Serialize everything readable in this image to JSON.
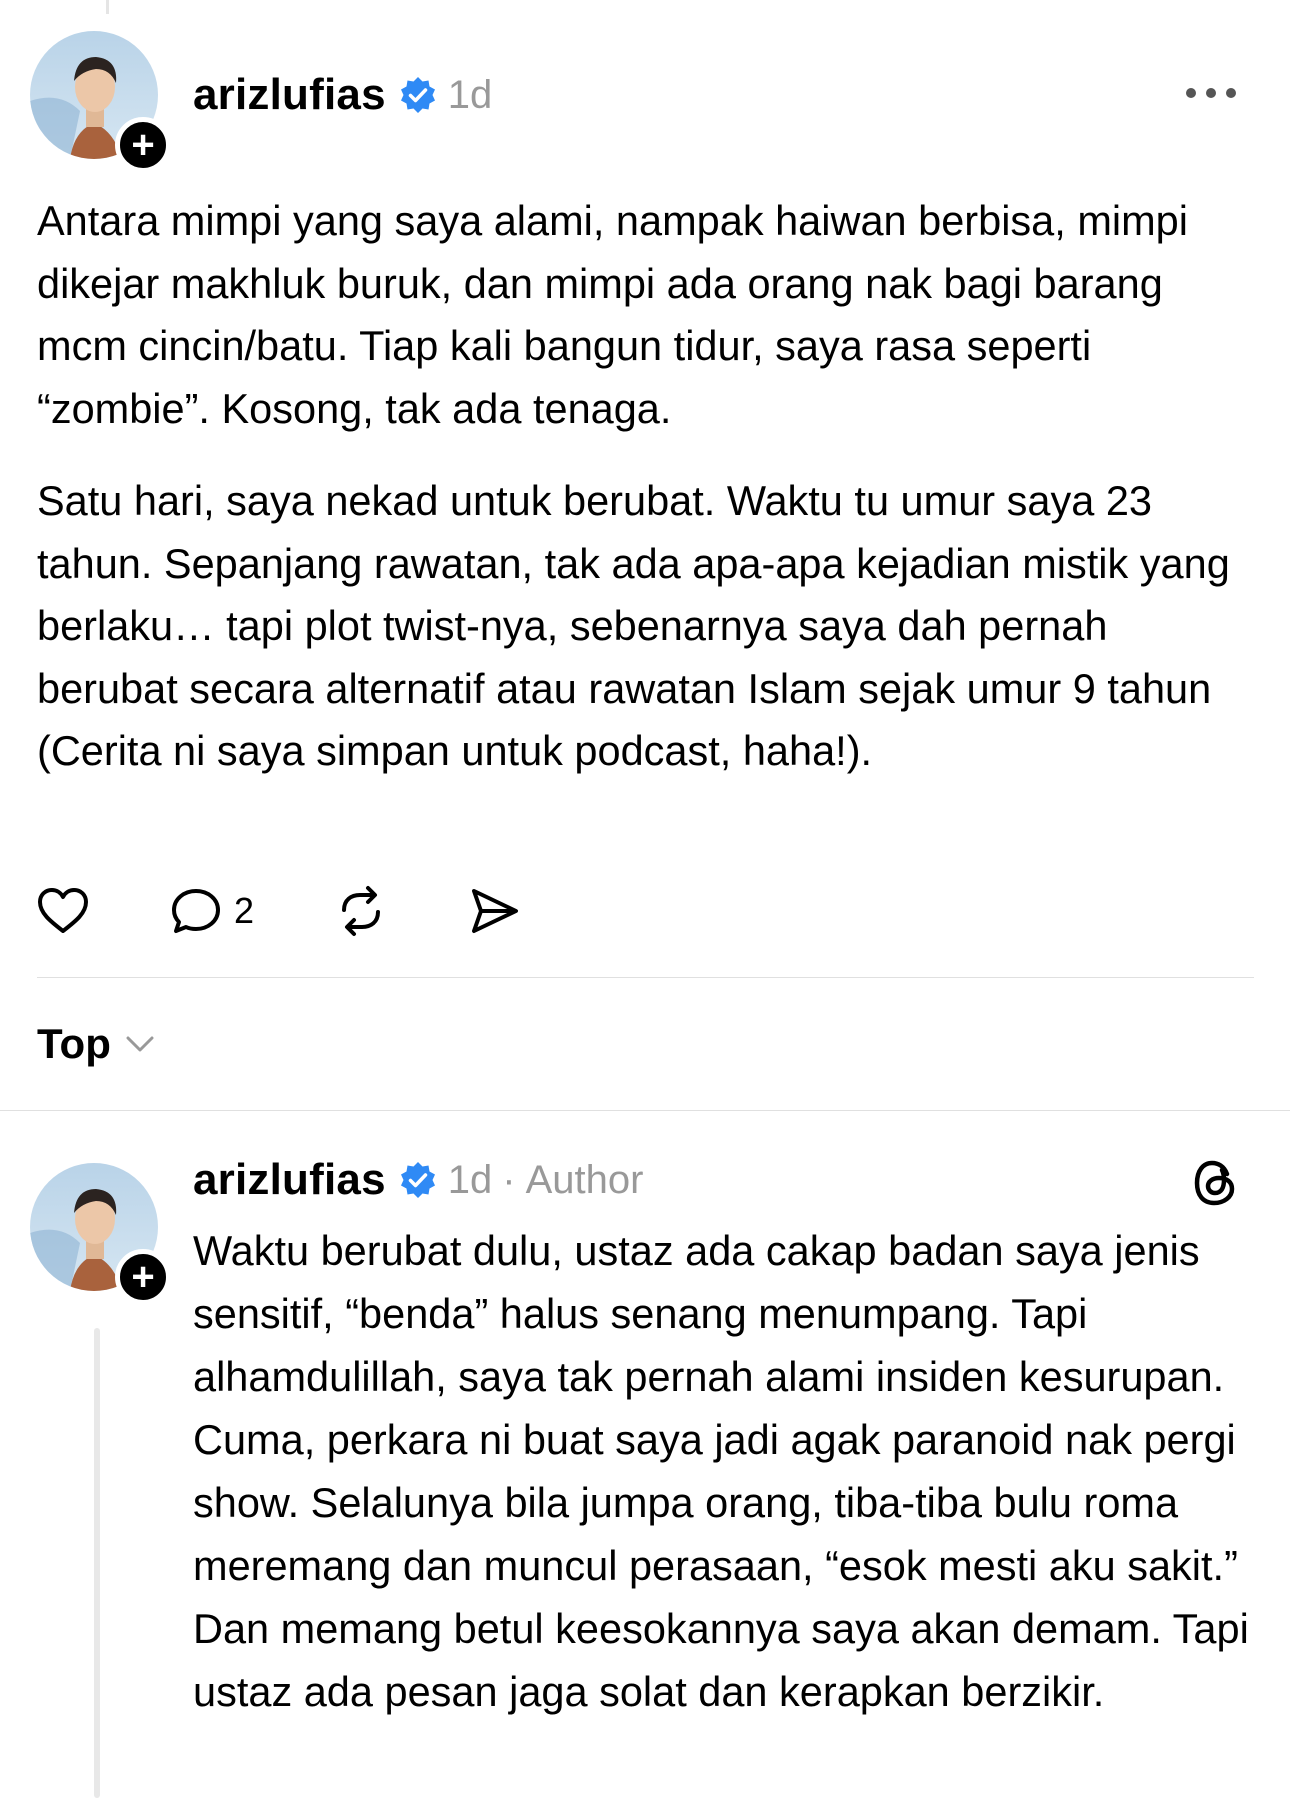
{
  "post": {
    "username": "arizlufias",
    "time": "1d",
    "paragraphs": [
      "Antara mimpi yang saya alami, nampak haiwan berbisa, mimpi dikejar makhluk buruk, dan mimpi ada orang nak bagi barang mcm cincin/batu. Tiap kali bangun tidur, saya rasa seperti “zombie”. Kosong, tak ada tenaga.",
      "Satu hari, saya nekad untuk berubat. Waktu tu umur saya 23 tahun. Sepanjang rawatan, tak ada apa-apa kejadian mistik yang berlaku… tapi plot twist-nya, sebenarnya saya dah pernah berubat secara alternatif atau rawatan Islam sejak umur 9 tahun (Cerita ni saya simpan untuk podcast, haha!)."
    ],
    "reply_count": "2"
  },
  "sort": {
    "label": "Top"
  },
  "reply": {
    "username": "arizlufias",
    "time": "1d",
    "separator": "·",
    "author_tag": "Author",
    "text": "Waktu berubat dulu, ustaz ada cakap badan saya jenis sensitif, “benda” halus senang menumpang. Tapi alhamdulillah, saya tak pernah alami insiden kesurupan. Cuma, perkara ni buat saya jadi agak paranoid nak pergi show. Selalunya bila jumpa orang, tiba-tiba bulu roma meremang dan muncul perasaan, “esok mesti aku sakit.” Dan memang betul keesokannya saya akan demam. Tapi ustaz ada pesan jaga solat dan kerapkan berzikir."
  },
  "icons": {
    "verified": "verified-badge-icon",
    "more": "more-options-icon",
    "like": "heart-icon",
    "comment": "comment-icon",
    "repost": "repost-icon",
    "share": "share-icon",
    "chevron": "chevron-down-icon",
    "threads": "threads-logo-icon",
    "follow": "plus-icon"
  },
  "colors": {
    "verified": "#2f8af5",
    "meta": "#999999",
    "divider": "#e0e0e0"
  }
}
